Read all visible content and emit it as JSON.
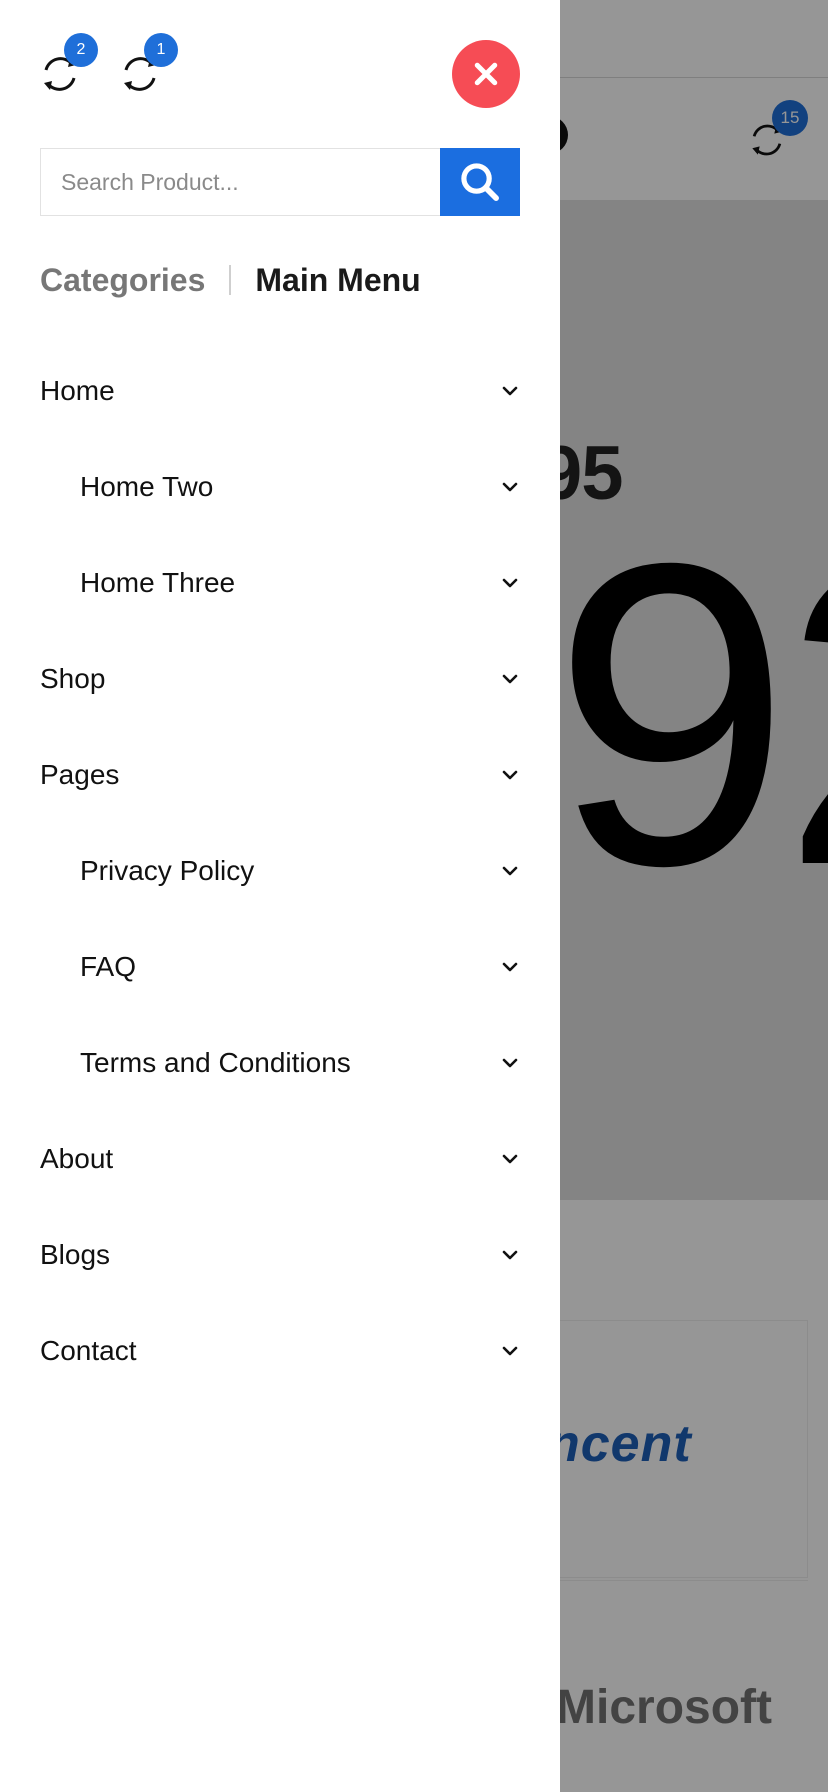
{
  "drawer": {
    "compare_badges": [
      "2",
      "1"
    ],
    "search": {
      "placeholder": "Search Product..."
    },
    "tabs": {
      "categories": "Categories",
      "main_menu": "Main Menu"
    },
    "menu_items": [
      {
        "label": "Home",
        "level": 0
      },
      {
        "label": "Home Two",
        "level": 1
      },
      {
        "label": "Home Three",
        "level": 1
      },
      {
        "label": "Shop",
        "level": 0
      },
      {
        "label": "Pages",
        "level": 0
      },
      {
        "label": "Privacy Policy",
        "level": 1
      },
      {
        "label": "FAQ",
        "level": 1
      },
      {
        "label": "Terms and Conditions",
        "level": 1
      },
      {
        "label": "About",
        "level": 0
      },
      {
        "label": "Blogs",
        "level": 0
      },
      {
        "label": "Contact",
        "level": 0
      }
    ]
  },
  "background": {
    "compare_badge": "15",
    "price_partial_small": "95",
    "price_partial_large": "92",
    "brands": [
      "ncent",
      "Microsoft"
    ]
  },
  "colors": {
    "accent_blue": "#1b6ee0",
    "badge_blue": "#1f6fd9",
    "close_red": "#f64c55",
    "overlay": "rgba(0,0,0,0.41)"
  },
  "icons": {
    "compare": "refresh-arrows-icon",
    "close": "close-x-icon",
    "search": "magnifier-icon",
    "chevron": "chevron-down-icon"
  }
}
